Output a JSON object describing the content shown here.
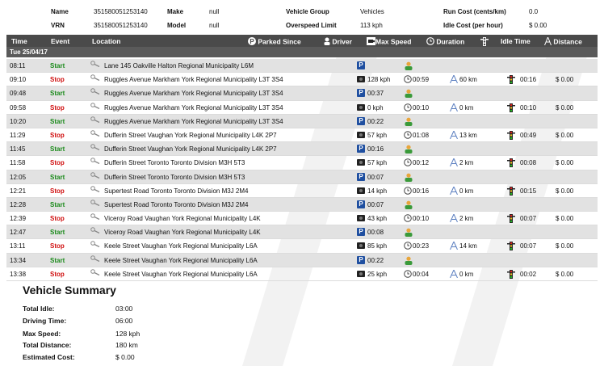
{
  "header": {
    "name_label": "Name",
    "name_value": "351580051253140",
    "vrn_label": "VRN",
    "vrn_value": "351580051253140",
    "make_label": "Make",
    "make_value": "null",
    "model_label": "Model",
    "model_value": "null",
    "group_label": "Vehicle Group",
    "group_value": "Vehicles",
    "overspeed_label": "Overspeed Limit",
    "overspeed_value": "113 kph",
    "runcost_label": "Run Cost (cents/km)",
    "runcost_value": "0.0",
    "idlecost_label": "Idle Cost (per hour)",
    "idlecost_value": "$ 0.00"
  },
  "columns": {
    "time": "Time",
    "event": "Event",
    "location": "Location",
    "parked": "Parked Since",
    "driver": "Driver",
    "maxspeed": "Max Speed",
    "duration": "Duration",
    "idle": "Idle Time",
    "distance": "Distance"
  },
  "date_group": "Tue 25/04/17",
  "rows": [
    {
      "time": "08:11",
      "event": "Start",
      "location": "Lane 145 Oakville Halton Regional Municipality L6M",
      "speed": "",
      "duration": "",
      "distance": "",
      "idle": "",
      "cost": ""
    },
    {
      "time": "09:10",
      "event": "Stop",
      "location": "Ruggles Avenue Markham York Regional Municipality L3T 3S4",
      "speed": "128 kph",
      "duration": "00:59",
      "distance": "60 km",
      "idle": "00:16",
      "cost": "$ 0.00"
    },
    {
      "time": "09:48",
      "event": "Start",
      "location": "Ruggles Avenue Markham York Regional Municipality L3T 3S4",
      "parked": "00:37",
      "speed": "",
      "duration": "",
      "distance": "",
      "idle": "",
      "cost": ""
    },
    {
      "time": "09:58",
      "event": "Stop",
      "location": "Ruggles Avenue Markham York Regional Municipality L3T 3S4",
      "speed": "0 kph",
      "duration": "00:10",
      "distance": "0 km",
      "idle": "00:10",
      "cost": "$ 0.00"
    },
    {
      "time": "10:20",
      "event": "Start",
      "location": "Ruggles Avenue Markham York Regional Municipality L3T 3S4",
      "parked": "00:22",
      "speed": "",
      "duration": "",
      "distance": "",
      "idle": "",
      "cost": ""
    },
    {
      "time": "11:29",
      "event": "Stop",
      "location": "Dufferin Street Vaughan York Regional Municipality L4K 2P7",
      "speed": "57 kph",
      "duration": "01:08",
      "distance": "13 km",
      "idle": "00:49",
      "cost": "$ 0.00"
    },
    {
      "time": "11:45",
      "event": "Start",
      "location": "Dufferin Street Vaughan York Regional Municipality L4K 2P7",
      "parked": "00:16",
      "speed": "",
      "duration": "",
      "distance": "",
      "idle": "",
      "cost": ""
    },
    {
      "time": "11:58",
      "event": "Stop",
      "location": "Dufferin Street Toronto Toronto Division M3H 5T3",
      "speed": "57 kph",
      "duration": "00:12",
      "distance": "2 km",
      "idle": "00:08",
      "cost": "$ 0.00"
    },
    {
      "time": "12:05",
      "event": "Start",
      "location": "Dufferin Street Toronto Toronto Division M3H 5T3",
      "parked": "00:07",
      "speed": "",
      "duration": "",
      "distance": "",
      "idle": "",
      "cost": ""
    },
    {
      "time": "12:21",
      "event": "Stop",
      "location": "Supertest Road Toronto Toronto Division M3J 2M4",
      "speed": "14 kph",
      "duration": "00:16",
      "distance": "0 km",
      "idle": "00:15",
      "cost": "$ 0.00"
    },
    {
      "time": "12:28",
      "event": "Start",
      "location": "Supertest Road Toronto Toronto Division M3J 2M4",
      "parked": "00:07",
      "speed": "",
      "duration": "",
      "distance": "",
      "idle": "",
      "cost": ""
    },
    {
      "time": "12:39",
      "event": "Stop",
      "location": "Viceroy Road Vaughan York Regional Municipality L4K",
      "speed": "43 kph",
      "duration": "00:10",
      "distance": "2 km",
      "idle": "00:07",
      "cost": "$ 0.00"
    },
    {
      "time": "12:47",
      "event": "Start",
      "location": "Viceroy Road Vaughan York Regional Municipality L4K",
      "parked": "00:08",
      "speed": "",
      "duration": "",
      "distance": "",
      "idle": "",
      "cost": ""
    },
    {
      "time": "13:11",
      "event": "Stop",
      "location": "Keele Street Vaughan York Regional Municipality L6A",
      "speed": "85 kph",
      "duration": "00:23",
      "distance": "14 km",
      "idle": "00:07",
      "cost": "$ 0.00"
    },
    {
      "time": "13:34",
      "event": "Start",
      "location": "Keele Street Vaughan York Regional Municipality L6A",
      "parked": "00:22",
      "speed": "",
      "duration": "",
      "distance": "",
      "idle": "",
      "cost": ""
    },
    {
      "time": "13:38",
      "event": "Stop",
      "location": "Keele Street Vaughan York Regional Municipality L6A",
      "speed": "25 kph",
      "duration": "00:04",
      "distance": "0 km",
      "idle": "00:02",
      "cost": "$ 0.00"
    }
  ],
  "summary": {
    "title": "Vehicle Summary",
    "idle_label": "Total Idle:",
    "idle_value": "03:00",
    "driving_label": "Driving Time:",
    "driving_value": "06:00",
    "maxspeed_label": "Max Speed:",
    "maxspeed_value": "128 kph",
    "distance_label": "Total Distance:",
    "distance_value": "180 km",
    "cost_label": "Estimated Cost:",
    "cost_value": "$ 0.00"
  },
  "colors": {
    "header_bg": "#4a4a4a",
    "start_green": "#1a8a1a",
    "stop_red": "#d01010",
    "parked_blue": "#1f4fa0",
    "start_row_bg": "#e2e2e2"
  },
  "icons": [
    "parked-icon",
    "driver-icon",
    "speed-camera-icon",
    "clock-icon",
    "traffic-light-icon",
    "distance-icon",
    "magnifier-icon"
  ]
}
